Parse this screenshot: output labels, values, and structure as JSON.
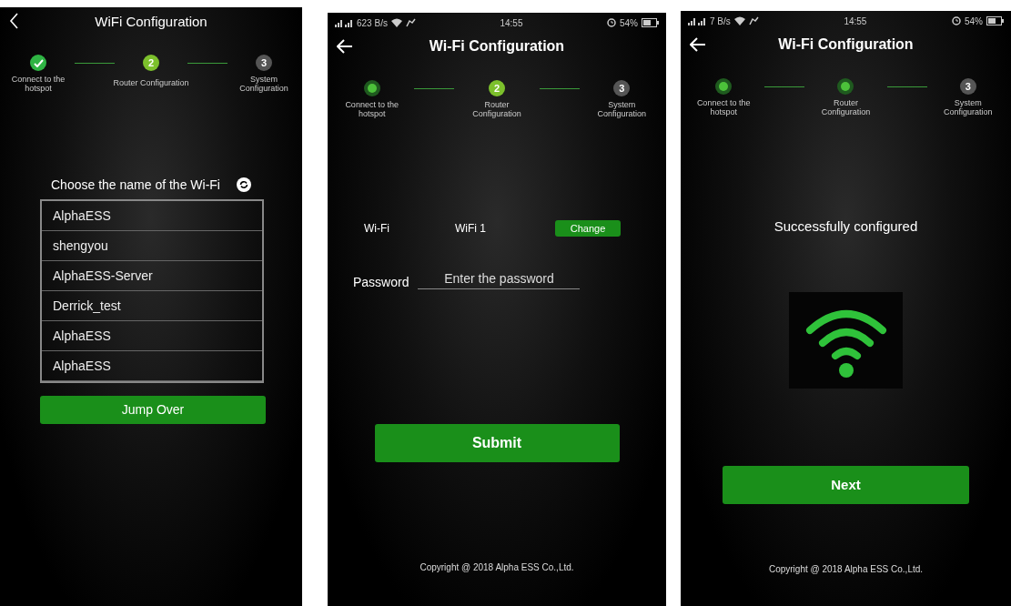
{
  "screens": [
    {
      "kind": "wifi_list",
      "back": {
        "kind": "chevron"
      },
      "title": "WiFi Configuration",
      "steps": [
        {
          "label": "Connect to the hotspot",
          "kind": "check"
        },
        {
          "label": "Router Configuration",
          "kind": "number",
          "number": "2",
          "selected": true
        },
        {
          "label": "System Configuration",
          "kind": "number",
          "number": "3",
          "selected": false
        }
      ],
      "prompt": "Choose the name of the Wi-Fi",
      "networks": [
        {
          "name": "AlphaESS"
        },
        {
          "name": "shengyou"
        },
        {
          "name": "AlphaESS-Server"
        },
        {
          "name": "Derrick_test"
        },
        {
          "name": "AlphaESS"
        },
        {
          "name": "AlphaESS"
        }
      ],
      "button": "Jump Over"
    },
    {
      "kind": "password",
      "back": {
        "kind": "arrow"
      },
      "status_bar": {
        "speed": "623 B/s",
        "time": "14:55",
        "battery": "54%"
      },
      "title": "Wi-Fi Configuration",
      "steps": [
        {
          "label": "Connect to the hotspot",
          "kind": "dot"
        },
        {
          "label": "Router Configuration",
          "kind": "number",
          "number": "2",
          "selected": true
        },
        {
          "label": "System Configuration",
          "kind": "number",
          "number": "3",
          "selected": false
        }
      ],
      "wifi_label": "Wi-Fi",
      "wifi_value": "WiFi 1",
      "change_button": "Change",
      "password_label": "Password",
      "password_placeholder": "Enter the password",
      "button": "Submit",
      "copyright": "Copyright @ 2018 Alpha ESS Co.,Ltd."
    },
    {
      "kind": "success",
      "back": {
        "kind": "arrow"
      },
      "status_bar": {
        "speed": "7 B/s",
        "time": "14:55",
        "battery": "54%"
      },
      "title": "Wi-Fi Configuration",
      "steps": [
        {
          "label": "Connect to the hotspot",
          "kind": "dot"
        },
        {
          "label": "Router Configuration",
          "kind": "dot"
        },
        {
          "label": "System Configuration",
          "kind": "number",
          "number": "3",
          "selected": false
        }
      ],
      "message": "Successfully configured",
      "button": "Next",
      "copyright": "Copyright @ 2018 Alpha ESS Co.,Ltd."
    }
  ]
}
